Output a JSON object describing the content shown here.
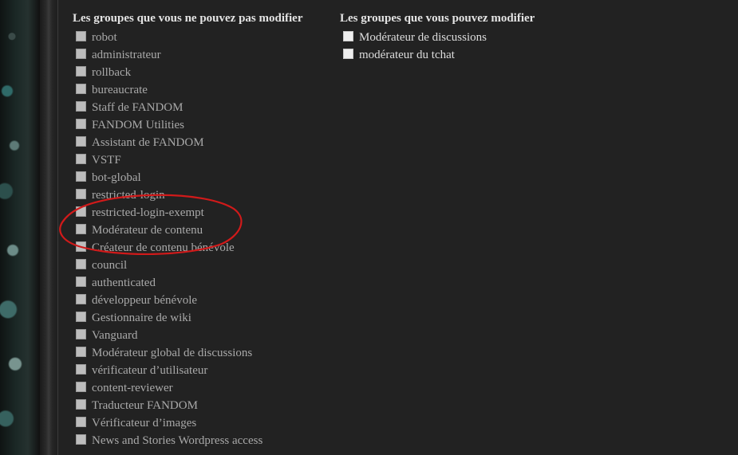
{
  "left_column": {
    "title": "Les groupes que vous ne pouvez pas modifier",
    "items": [
      {
        "label": "robot"
      },
      {
        "label": "administrateur"
      },
      {
        "label": "rollback"
      },
      {
        "label": "bureaucrate"
      },
      {
        "label": "Staff de FANDOM"
      },
      {
        "label": "FANDOM Utilities"
      },
      {
        "label": "Assistant de FANDOM"
      },
      {
        "label": "VSTF"
      },
      {
        "label": "bot-global"
      },
      {
        "label": "restricted-login"
      },
      {
        "label": "restricted-login-exempt"
      },
      {
        "label": "Modérateur de contenu"
      },
      {
        "label": "Créateur de contenu bénévole"
      },
      {
        "label": "council"
      },
      {
        "label": "authenticated"
      },
      {
        "label": "développeur bénévole"
      },
      {
        "label": "Gestionnaire de wiki"
      },
      {
        "label": "Vanguard"
      },
      {
        "label": "Modérateur global de discussions"
      },
      {
        "label": "vérificateur d’utilisateur"
      },
      {
        "label": "content-reviewer"
      },
      {
        "label": "Traducteur FANDOM"
      },
      {
        "label": "Vérificateur d’images"
      },
      {
        "label": "News and Stories Wordpress access"
      }
    ]
  },
  "right_column": {
    "title": "Les groupes que vous pouvez modifier",
    "items": [
      {
        "label": "Modérateur de discussions"
      },
      {
        "label": "modérateur du tchat"
      }
    ]
  },
  "colors": {
    "background": "#222222",
    "annotation_circle": "#d11a1a",
    "disabled_text": "#a9a9a9",
    "enabled_text": "#dddddd"
  }
}
